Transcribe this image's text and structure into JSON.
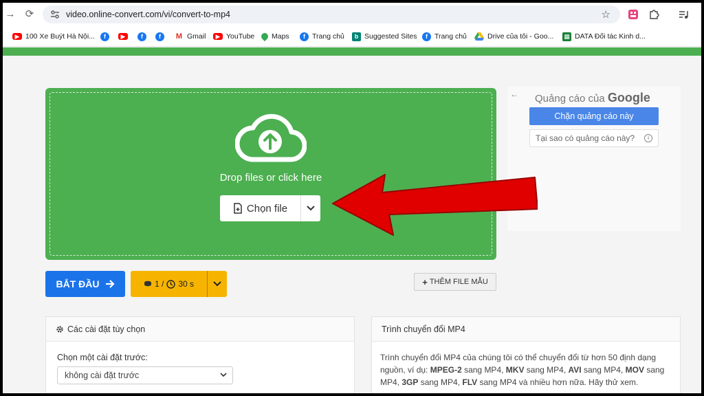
{
  "browser": {
    "url": "video.online-convert.com/vi/convert-to-mp4"
  },
  "bookmarks": [
    {
      "label": "100 Xe Buýt Hà Nội...",
      "icon": "youtube-icon"
    },
    {
      "label": "",
      "icon": "facebook-icon"
    },
    {
      "label": "",
      "icon": "youtube-icon"
    },
    {
      "label": "",
      "icon": "facebook-icon"
    },
    {
      "label": "",
      "icon": "facebook-icon"
    },
    {
      "label": "Gmail",
      "icon": "gmail-icon"
    },
    {
      "label": "YouTube",
      "icon": "youtube-icon"
    },
    {
      "label": "Maps",
      "icon": "maps-icon"
    },
    {
      "label": "Trang chủ",
      "icon": "facebook-icon"
    },
    {
      "label": "Suggested Sites",
      "icon": "bing-icon"
    },
    {
      "label": "Trang chủ",
      "icon": "facebook-icon"
    },
    {
      "label": "Drive của tôi - Goo...",
      "icon": "drive-icon"
    },
    {
      "label": "DATA Đối tác Kinh d...",
      "icon": "sheets-icon"
    }
  ],
  "upload": {
    "drop_text": "Drop files or click here",
    "choose_label": "Chọn file"
  },
  "ad": {
    "title_prefix": "Quảng cáo của",
    "title_brand": "Google",
    "block_label": "Chặn quảng cáo này",
    "why_label": "Tại sao có quảng cáo này?"
  },
  "actions": {
    "start_label": "BẮT ĐẦU",
    "credits_count": "1 /",
    "credits_time": "30 s",
    "sample_label": "THÊM FILE MẪU"
  },
  "settings_panel": {
    "title": "Các cài đặt tùy chọn",
    "preset_label": "Chọn một cài đặt trước:",
    "preset_value": "không cài đặt trước"
  },
  "info_panel": {
    "title": "Trình chuyển đổi MP4",
    "desc_1": "Trình chuyển đổi MP4 của chúng tôi có thể chuyển đổi từ hơn 50 định dạng nguồn, ví dụ: ",
    "f1": "MPEG-2",
    "t1": " sang MP4, ",
    "f2": "MKV",
    "t2": " sang MP4, ",
    "f3": "AVI",
    "t3": " sang MP4, ",
    "f4": "MOV",
    "t4": " sang MP4, ",
    "f5": "3GP",
    "t5": " sang MP4, ",
    "f6": "FLV",
    "t6": " sang MP4 và nhiều hơn nữa. Hãy thử xem."
  },
  "colors": {
    "green": "#4caf50",
    "blue": "#1a73e8",
    "orange": "#f6b400",
    "arrow_red": "#e00000"
  }
}
